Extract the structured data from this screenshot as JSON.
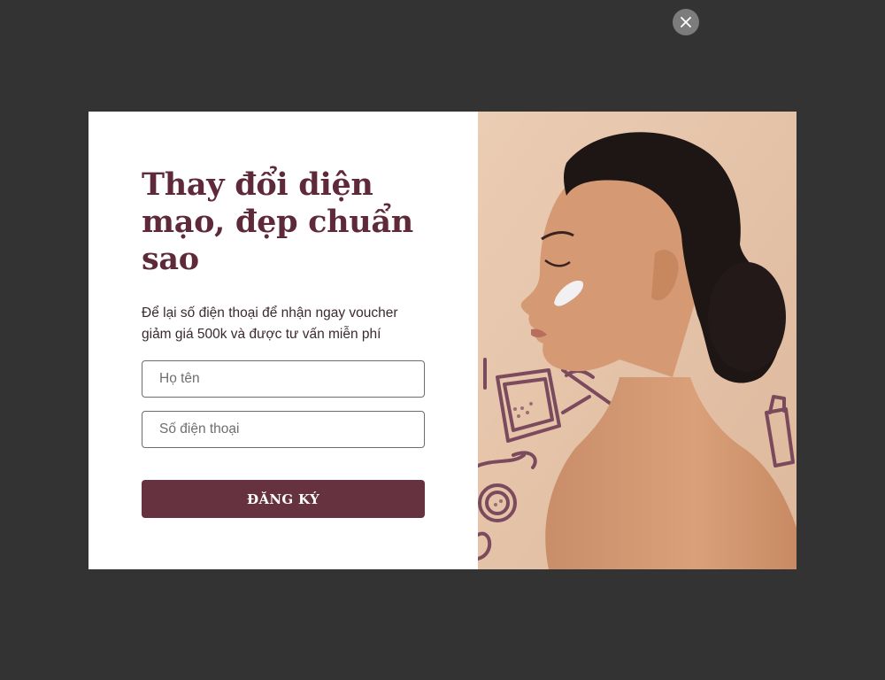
{
  "popup": {
    "title": "Thay đổi diện mạo, đẹp chuẩn sao",
    "subtitle": "Để lại số điện thoại để nhận ngay voucher giảm giá 500k và được tư vấn miễn phí",
    "name_placeholder": "Họ tên",
    "phone_placeholder": "Số điện thoại",
    "submit_label": "ĐĂNG KÝ",
    "close_icon": "close-icon"
  },
  "colors": {
    "backdrop": "#333333",
    "title": "#5e2a3a",
    "button": "#67323f",
    "image_bg": "#e7c7ad",
    "close_button": "#7c7c7c"
  }
}
